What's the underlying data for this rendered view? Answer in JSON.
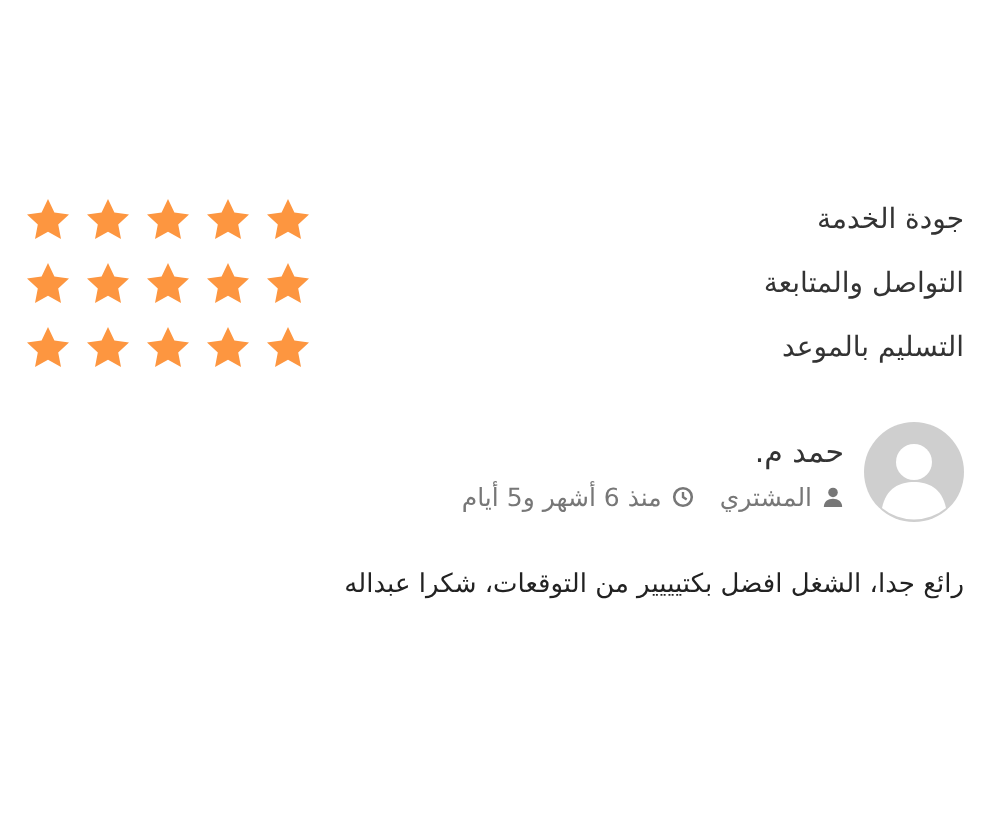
{
  "ratings": [
    {
      "label": "جودة الخدمة",
      "stars": 5
    },
    {
      "label": "التواصل والمتابعة",
      "stars": 5
    },
    {
      "label": "التسليم بالموعد",
      "stars": 5
    }
  ],
  "review": {
    "name": "حمد م.",
    "role": "المشتري",
    "time": "منذ 6 أشهر و5 أيام",
    "comment": "رائع جدا، الشغل افضل بكتيييير من التوقعات، شكرا عبداله"
  }
}
